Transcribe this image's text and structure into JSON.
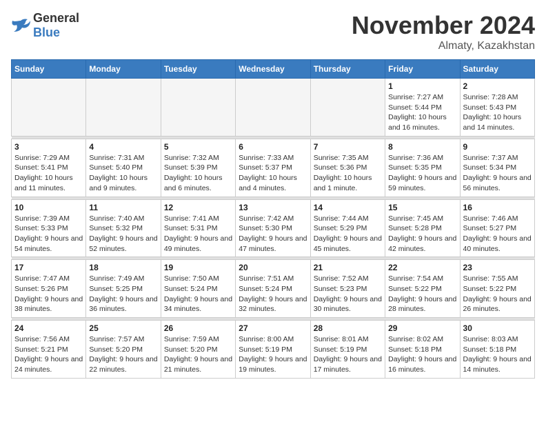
{
  "logo": {
    "general": "General",
    "blue": "Blue"
  },
  "title": "November 2024",
  "location": "Almaty, Kazakhstan",
  "days_of_week": [
    "Sunday",
    "Monday",
    "Tuesday",
    "Wednesday",
    "Thursday",
    "Friday",
    "Saturday"
  ],
  "weeks": [
    [
      {
        "day": "",
        "info": ""
      },
      {
        "day": "",
        "info": ""
      },
      {
        "day": "",
        "info": ""
      },
      {
        "day": "",
        "info": ""
      },
      {
        "day": "",
        "info": ""
      },
      {
        "day": "1",
        "info": "Sunrise: 7:27 AM\nSunset: 5:44 PM\nDaylight: 10 hours and 16 minutes."
      },
      {
        "day": "2",
        "info": "Sunrise: 7:28 AM\nSunset: 5:43 PM\nDaylight: 10 hours and 14 minutes."
      }
    ],
    [
      {
        "day": "3",
        "info": "Sunrise: 7:29 AM\nSunset: 5:41 PM\nDaylight: 10 hours and 11 minutes."
      },
      {
        "day": "4",
        "info": "Sunrise: 7:31 AM\nSunset: 5:40 PM\nDaylight: 10 hours and 9 minutes."
      },
      {
        "day": "5",
        "info": "Sunrise: 7:32 AM\nSunset: 5:39 PM\nDaylight: 10 hours and 6 minutes."
      },
      {
        "day": "6",
        "info": "Sunrise: 7:33 AM\nSunset: 5:37 PM\nDaylight: 10 hours and 4 minutes."
      },
      {
        "day": "7",
        "info": "Sunrise: 7:35 AM\nSunset: 5:36 PM\nDaylight: 10 hours and 1 minute."
      },
      {
        "day": "8",
        "info": "Sunrise: 7:36 AM\nSunset: 5:35 PM\nDaylight: 9 hours and 59 minutes."
      },
      {
        "day": "9",
        "info": "Sunrise: 7:37 AM\nSunset: 5:34 PM\nDaylight: 9 hours and 56 minutes."
      }
    ],
    [
      {
        "day": "10",
        "info": "Sunrise: 7:39 AM\nSunset: 5:33 PM\nDaylight: 9 hours and 54 minutes."
      },
      {
        "day": "11",
        "info": "Sunrise: 7:40 AM\nSunset: 5:32 PM\nDaylight: 9 hours and 52 minutes."
      },
      {
        "day": "12",
        "info": "Sunrise: 7:41 AM\nSunset: 5:31 PM\nDaylight: 9 hours and 49 minutes."
      },
      {
        "day": "13",
        "info": "Sunrise: 7:42 AM\nSunset: 5:30 PM\nDaylight: 9 hours and 47 minutes."
      },
      {
        "day": "14",
        "info": "Sunrise: 7:44 AM\nSunset: 5:29 PM\nDaylight: 9 hours and 45 minutes."
      },
      {
        "day": "15",
        "info": "Sunrise: 7:45 AM\nSunset: 5:28 PM\nDaylight: 9 hours and 42 minutes."
      },
      {
        "day": "16",
        "info": "Sunrise: 7:46 AM\nSunset: 5:27 PM\nDaylight: 9 hours and 40 minutes."
      }
    ],
    [
      {
        "day": "17",
        "info": "Sunrise: 7:47 AM\nSunset: 5:26 PM\nDaylight: 9 hours and 38 minutes."
      },
      {
        "day": "18",
        "info": "Sunrise: 7:49 AM\nSunset: 5:25 PM\nDaylight: 9 hours and 36 minutes."
      },
      {
        "day": "19",
        "info": "Sunrise: 7:50 AM\nSunset: 5:24 PM\nDaylight: 9 hours and 34 minutes."
      },
      {
        "day": "20",
        "info": "Sunrise: 7:51 AM\nSunset: 5:24 PM\nDaylight: 9 hours and 32 minutes."
      },
      {
        "day": "21",
        "info": "Sunrise: 7:52 AM\nSunset: 5:23 PM\nDaylight: 9 hours and 30 minutes."
      },
      {
        "day": "22",
        "info": "Sunrise: 7:54 AM\nSunset: 5:22 PM\nDaylight: 9 hours and 28 minutes."
      },
      {
        "day": "23",
        "info": "Sunrise: 7:55 AM\nSunset: 5:22 PM\nDaylight: 9 hours and 26 minutes."
      }
    ],
    [
      {
        "day": "24",
        "info": "Sunrise: 7:56 AM\nSunset: 5:21 PM\nDaylight: 9 hours and 24 minutes."
      },
      {
        "day": "25",
        "info": "Sunrise: 7:57 AM\nSunset: 5:20 PM\nDaylight: 9 hours and 22 minutes."
      },
      {
        "day": "26",
        "info": "Sunrise: 7:59 AM\nSunset: 5:20 PM\nDaylight: 9 hours and 21 minutes."
      },
      {
        "day": "27",
        "info": "Sunrise: 8:00 AM\nSunset: 5:19 PM\nDaylight: 9 hours and 19 minutes."
      },
      {
        "day": "28",
        "info": "Sunrise: 8:01 AM\nSunset: 5:19 PM\nDaylight: 9 hours and 17 minutes."
      },
      {
        "day": "29",
        "info": "Sunrise: 8:02 AM\nSunset: 5:18 PM\nDaylight: 9 hours and 16 minutes."
      },
      {
        "day": "30",
        "info": "Sunrise: 8:03 AM\nSunset: 5:18 PM\nDaylight: 9 hours and 14 minutes."
      }
    ]
  ]
}
